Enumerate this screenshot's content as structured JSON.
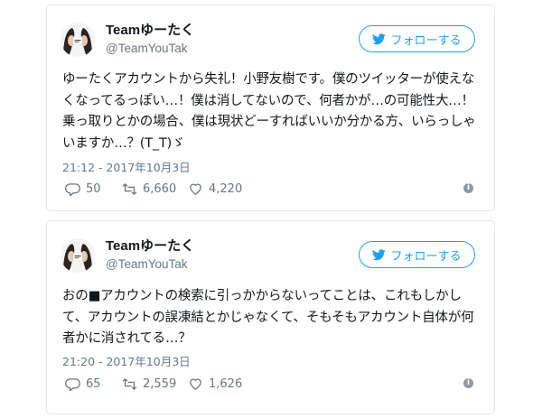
{
  "tweets": [
    {
      "display_name": "Teamゆーたく",
      "handle": "@TeamYouTak",
      "follow_label": "フォローする",
      "text": "ゆーたくアカウントから失礼！小野友樹です。僕のツイッターが使えなくなってるっぽい…！僕は消してないので、何者かが…の可能性大…！乗っ取りとかの場合、僕は現状どーすればいいか分かる方、いらっしゃいますか…？(T_T)ゞ",
      "timestamp": "21:12 - 2017年10月3日",
      "replies": "50",
      "retweets": "6,660",
      "likes": "4,220"
    },
    {
      "display_name": "Teamゆーたく",
      "handle": "@TeamYouTak",
      "follow_label": "フォローする",
      "text": "おの■アカウントの検索に引っかからないってことは、これもしかして、アカウントの誤凍結とかじゃなくて、そもそもアカウント自体が何者かに消されてる…？",
      "timestamp": "21:20 - 2017年10月3日",
      "replies": "65",
      "retweets": "2,559",
      "likes": "1,626"
    }
  ],
  "colors": {
    "accent": "#1da1f2",
    "text": "#14171a",
    "muted": "#657786",
    "border": "#e1e8ed"
  },
  "icons": [
    "avatar",
    "twitter-bird-icon",
    "reply-icon",
    "retweet-icon",
    "like-icon",
    "info-icon"
  ]
}
